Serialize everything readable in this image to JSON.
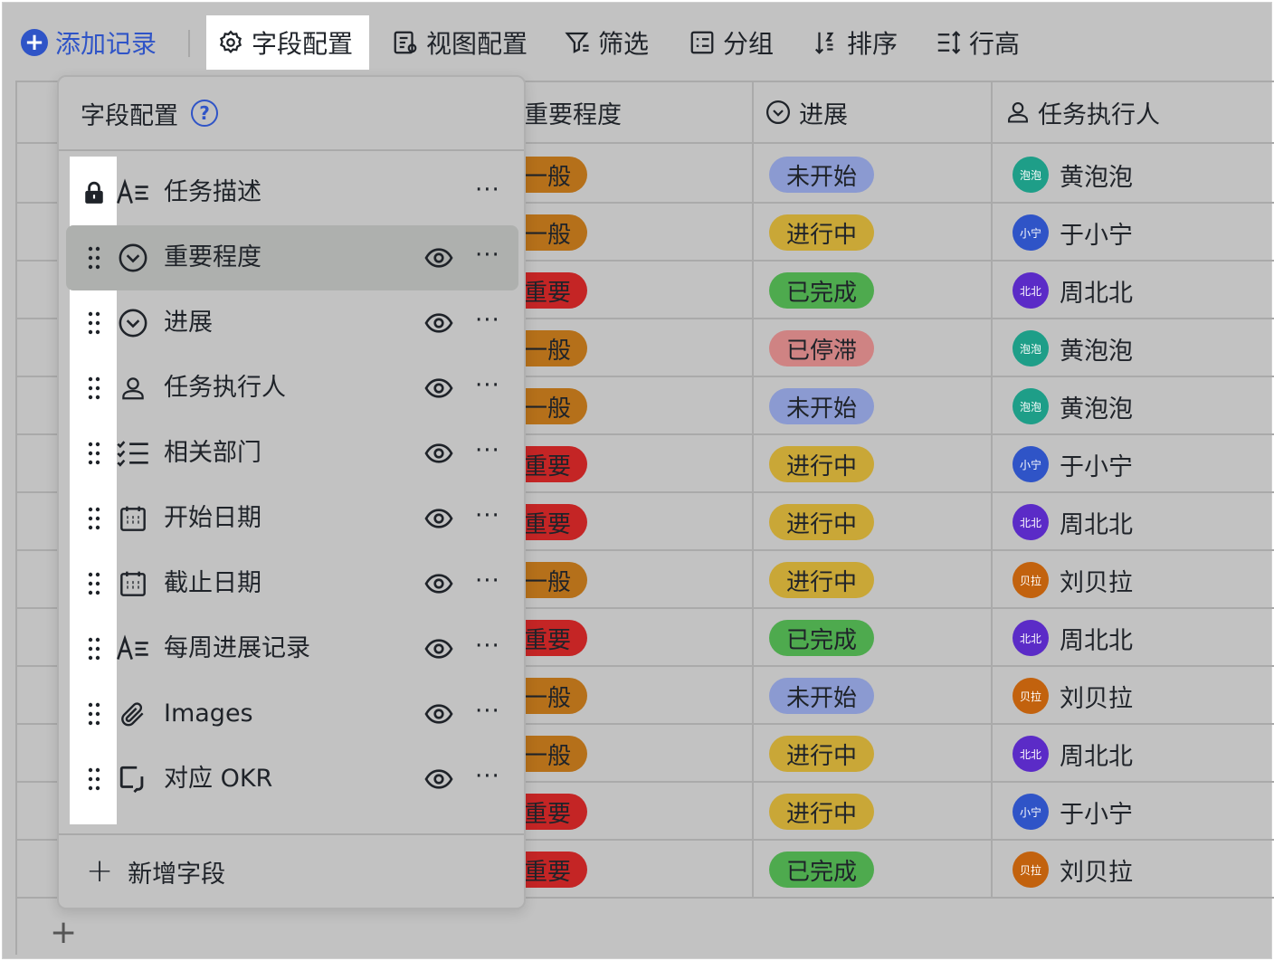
{
  "toolbar": {
    "add_record": "添加记录",
    "field_config": "字段配置",
    "view_config": "视图配置",
    "filter": "筛选",
    "group": "分组",
    "sort": "排序",
    "row_height": "行高"
  },
  "table": {
    "headers": {
      "importance": "重要程度",
      "progress": "进展",
      "assignee": "任务执行人"
    },
    "rows": [
      {
        "importance": "一般",
        "importance_color": "#b5701a",
        "progress": "未开始",
        "progress_color": "#8b9ad1",
        "assignee": "黄泡泡",
        "avatar": "泡泡",
        "avatar_color": "#1e9e88"
      },
      {
        "importance": "一般",
        "importance_color": "#b5701a",
        "progress": "进行中",
        "progress_color": "#c9a737",
        "assignee": "于小宁",
        "avatar": "小宁",
        "avatar_color": "#2f54c7"
      },
      {
        "importance": "重要",
        "importance_color": "#c42525",
        "progress": "已完成",
        "progress_color": "#4eaa4e",
        "assignee": "周北北",
        "avatar": "北北",
        "avatar_color": "#5b2bc7"
      },
      {
        "importance": "一般",
        "importance_color": "#b5701a",
        "progress": "已停滞",
        "progress_color": "#cf8383",
        "assignee": "黄泡泡",
        "avatar": "泡泡",
        "avatar_color": "#1e9e88"
      },
      {
        "importance": "一般",
        "importance_color": "#b5701a",
        "progress": "未开始",
        "progress_color": "#8b9ad1",
        "assignee": "黄泡泡",
        "avatar": "泡泡",
        "avatar_color": "#1e9e88"
      },
      {
        "importance": "重要",
        "importance_color": "#c42525",
        "progress": "进行中",
        "progress_color": "#c9a737",
        "assignee": "于小宁",
        "avatar": "小宁",
        "avatar_color": "#2f54c7"
      },
      {
        "importance": "重要",
        "importance_color": "#c42525",
        "progress": "进行中",
        "progress_color": "#c9a737",
        "assignee": "周北北",
        "avatar": "北北",
        "avatar_color": "#5b2bc7"
      },
      {
        "importance": "一般",
        "importance_color": "#b5701a",
        "progress": "进行中",
        "progress_color": "#c9a737",
        "assignee": "刘贝拉",
        "avatar": "贝拉",
        "avatar_color": "#c2620e"
      },
      {
        "importance": "重要",
        "importance_color": "#c42525",
        "progress": "已完成",
        "progress_color": "#4eaa4e",
        "assignee": "周北北",
        "avatar": "北北",
        "avatar_color": "#5b2bc7"
      },
      {
        "importance": "一般",
        "importance_color": "#b5701a",
        "progress": "未开始",
        "progress_color": "#8b9ad1",
        "assignee": "刘贝拉",
        "avatar": "贝拉",
        "avatar_color": "#c2620e"
      },
      {
        "importance": "一般",
        "importance_color": "#b5701a",
        "progress": "进行中",
        "progress_color": "#c9a737",
        "assignee": "周北北",
        "avatar": "北北",
        "avatar_color": "#5b2bc7"
      },
      {
        "importance": "重要",
        "importance_color": "#c42525",
        "progress": "进行中",
        "progress_color": "#c9a737",
        "assignee": "于小宁",
        "avatar": "小宁",
        "avatar_color": "#2f54c7"
      },
      {
        "importance": "重要",
        "importance_color": "#c42525",
        "progress": "已完成",
        "progress_color": "#4eaa4e",
        "assignee": "刘贝拉",
        "avatar": "贝拉",
        "avatar_color": "#c2620e"
      }
    ]
  },
  "panel": {
    "title": "字段配置",
    "help": "?",
    "fields": [
      {
        "label": "任务描述",
        "icon": "text-icon",
        "lead": "lock-icon",
        "visible": false
      },
      {
        "label": "重要程度",
        "icon": "single-select-icon",
        "lead": "drag-handle-icon",
        "visible": true
      },
      {
        "label": "进展",
        "icon": "single-select-icon",
        "lead": "drag-handle-icon",
        "visible": true
      },
      {
        "label": "任务执行人",
        "icon": "person-icon",
        "lead": "drag-handle-icon",
        "visible": true
      },
      {
        "label": "相关部门",
        "icon": "multi-select-icon",
        "lead": "drag-handle-icon",
        "visible": true
      },
      {
        "label": "开始日期",
        "icon": "calendar-icon",
        "lead": "drag-handle-icon",
        "visible": true
      },
      {
        "label": "截止日期",
        "icon": "calendar-icon",
        "lead": "drag-handle-icon",
        "visible": true
      },
      {
        "label": "每周进展记录",
        "icon": "text-icon",
        "lead": "drag-handle-icon",
        "visible": true
      },
      {
        "label": "Images",
        "icon": "attachment-icon",
        "lead": "drag-handle-icon",
        "visible": true
      },
      {
        "label": "对应 OKR",
        "icon": "link-icon",
        "lead": "drag-handle-icon",
        "visible": true
      }
    ],
    "more": "···",
    "add_field": "新增字段"
  },
  "add_row": "+"
}
